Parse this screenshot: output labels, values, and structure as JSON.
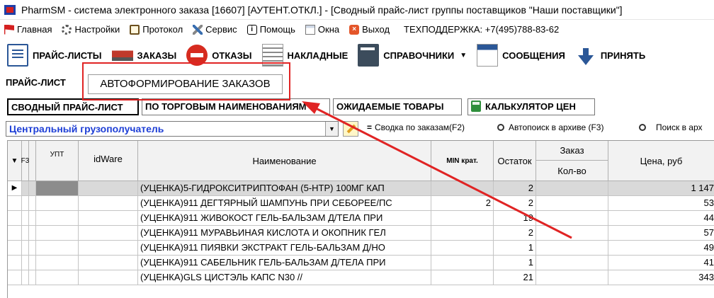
{
  "window": {
    "title": "PharmSM - система электронного заказа [16607] [АУТЕНТ.ОТКЛ.] - [Сводный прайс-лист группы поставщиков \"Наши поставщики\"]"
  },
  "menu": {
    "items": [
      {
        "label": "Главная",
        "icon": "flag-icon"
      },
      {
        "label": "Настройки",
        "icon": "gear-icon"
      },
      {
        "label": "Протокол",
        "icon": "clipboard-icon"
      },
      {
        "label": "Сервис",
        "icon": "tools-icon"
      },
      {
        "label": "Помощь",
        "icon": "help-icon"
      },
      {
        "label": "Окна",
        "icon": "windows-icon"
      },
      {
        "label": "Выход",
        "icon": "exit-icon"
      }
    ],
    "support": "ТЕХПОДДЕРЖКА: +7(495)788-83-62"
  },
  "toolbar": {
    "price_lists": "ПРАЙС-ЛИСТЫ",
    "orders": "ЗАКАЗЫ",
    "refusals": "ОТКАЗЫ",
    "invoices": "НАКЛАДНЫЕ",
    "directories": "СПРАВОЧНИКИ",
    "messages": "СООБЩЕНИЯ",
    "accept": "ПРИНЯТЬ"
  },
  "top_tabs": {
    "price_list": "ПРАЙС-ЛИСТ",
    "auto_orders": "АВТОФОРМИРОВАНИЕ ЗАКАЗОВ"
  },
  "sub_tabs": {
    "summary": "СВОДНЫЙ ПРАЙС-ЛИСТ",
    "by_trade_name": "ПО ТОРГОВЫМ НАИМЕНОВАНИЯМ",
    "expected": "ОЖИДАЕМЫЕ ТОВАРЫ",
    "calculator": "КАЛЬКУЛЯТОР ЦЕН"
  },
  "filter": {
    "consignee": "Центральный грузополучатель",
    "summary_btn_glyph": "=",
    "summary_btn": "Сводка по заказам(F2)",
    "autosearch_btn": "Автопоиск в архиве (F3)",
    "search_archive_btn": "Поиск в арх"
  },
  "grid": {
    "headers": {
      "f3": "F3",
      "upt": "УПТ",
      "idware": "idWare",
      "name": "Наименование",
      "min_krat": "MIN крат.",
      "ostatok": "Остаток",
      "zakaz": "Заказ",
      "kolvo": "Кол-во",
      "price": "Цена, руб"
    },
    "rows": [
      {
        "name": "(УЦЕНКА)5-ГИДРОКСИТРИПТОФАН (5-HTP) 100МГ КАП",
        "min": "",
        "ostatok": "2",
        "price": "1 147"
      },
      {
        "name": "(УЦЕНКА)911 ДЕГТЯРНЫЙ ШАМПУНЬ ПРИ СЕБОРЕЕ/ПС",
        "min": "2",
        "ostatok": "2",
        "price": "53"
      },
      {
        "name": "(УЦЕНКА)911 ЖИВОКОСТ ГЕЛЬ-БАЛЬЗАМ Д/ТЕЛА ПРИ",
        "min": "",
        "ostatok": "19",
        "price": "44"
      },
      {
        "name": "(УЦЕНКА)911 МУРАВЬИНАЯ КИСЛОТА И ОКОПНИК ГЕЛ",
        "min": "",
        "ostatok": "2",
        "price": "57"
      },
      {
        "name": "(УЦЕНКА)911 ПИЯВКИ ЭКСТРАКТ ГЕЛЬ-БАЛЬЗАМ Д/НО",
        "min": "",
        "ostatok": "1",
        "price": "49"
      },
      {
        "name": "(УЦЕНКА)911 САБЕЛЬНИК ГЕЛЬ-БАЛЬЗАМ Д/ТЕЛА ПРИ",
        "min": "",
        "ostatok": "1",
        "price": "41"
      },
      {
        "name": "(УЦЕНКА)GLS ЦИСТЭЛЬ КАПС N30 //",
        "min": "",
        "ostatok": "21",
        "price": "343"
      }
    ]
  },
  "colors": {
    "annotation": "#e02424",
    "consignee_text": "#1e3fd6"
  }
}
